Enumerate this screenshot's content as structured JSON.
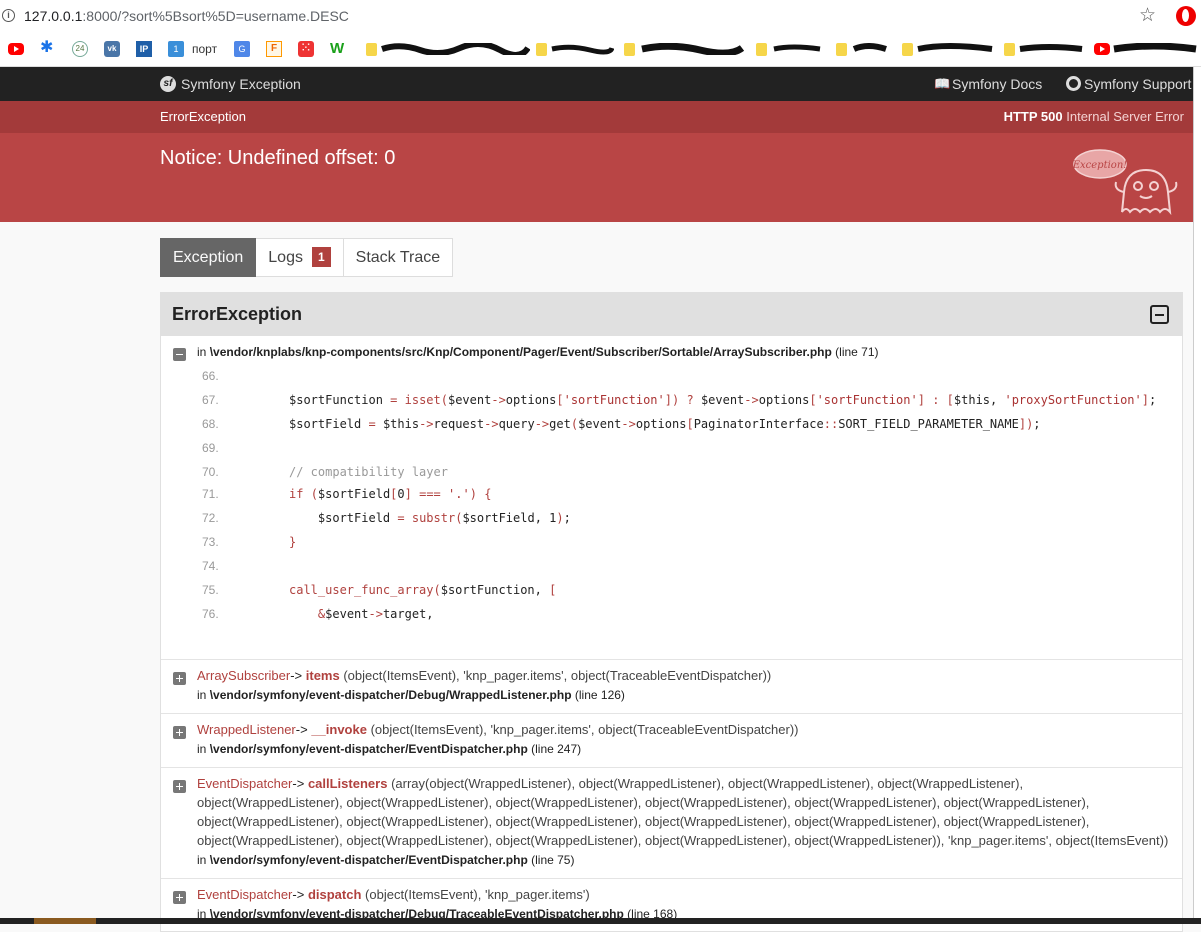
{
  "browser": {
    "url_host": "127.0.0.1",
    "url_rest": ":8000/?sort%5Bsort%5D=username.DESC",
    "bookmark_text": "порт"
  },
  "header": {
    "title": "Symfony Exception",
    "docs": "Symfony Docs",
    "support": "Symfony Support"
  },
  "error": {
    "class": "ErrorException",
    "status_code": "HTTP 500",
    "status_text": "Internal Server Error",
    "message": "Notice: Undefined offset: 0",
    "ghost_label": "Exception!"
  },
  "tabs": [
    {
      "label": "Exception"
    },
    {
      "label": "Logs",
      "badge": "1"
    },
    {
      "label": "Stack Trace"
    }
  ],
  "panel": {
    "title": "ErrorException",
    "first_trace": {
      "prefix": "in",
      "file": "\\vendor/knplabs/knp-components/src/Knp/Component/Pager/Event/Subscriber/Sortable/ArraySubscriber.php",
      "line": "(line 71)"
    },
    "code_lines": [
      {
        "num": "66.",
        "code": ""
      },
      {
        "num": "67.",
        "code": "        $sortFunction = isset($event->options['sortFunction']) ? $event->options['sortFunction'] : [$this, 'proxySortFunction'];"
      },
      {
        "num": "68.",
        "code": "        $sortField = $this->request->query->get($event->options[PaginatorInterface::SORT_FIELD_PARAMETER_NAME]);"
      },
      {
        "num": "69.",
        "code": ""
      },
      {
        "num": "70.",
        "code": "        // compatibility layer"
      },
      {
        "num": "71.",
        "code": "        if ($sortField[0] === '.') {"
      },
      {
        "num": "72.",
        "code": "            $sortField = substr($sortField, 1);"
      },
      {
        "num": "73.",
        "code": "        }"
      },
      {
        "num": "74.",
        "code": ""
      },
      {
        "num": "75.",
        "code": "        call_user_func_array($sortFunction, ["
      },
      {
        "num": "76.",
        "code": "            &$event->target,"
      }
    ],
    "traces": [
      {
        "cls": "ArraySubscriber",
        "arrow": "->",
        "fn": "items",
        "args": "(object(ItemsEvent), 'knp_pager.items', object(TraceableEventDispatcher))",
        "prefix": "in",
        "file": "\\vendor/symfony/event-dispatcher/Debug/WrappedListener.php",
        "line": "(line 126)"
      },
      {
        "cls": "WrappedListener",
        "arrow": "->",
        "fn": "__invoke",
        "args": "(object(ItemsEvent), 'knp_pager.items', object(TraceableEventDispatcher))",
        "prefix": "in",
        "file": "\\vendor/symfony/event-dispatcher/EventDispatcher.php",
        "line": "(line 247)"
      },
      {
        "cls": "EventDispatcher",
        "arrow": "->",
        "fn": "callListeners",
        "args": "(array(object(WrappedListener), object(WrappedListener), object(WrappedListener), object(WrappedListener), object(WrappedListener), object(WrappedListener), object(WrappedListener), object(WrappedListener), object(WrappedListener), object(WrappedListener), object(WrappedListener), object(WrappedListener), object(WrappedListener), object(WrappedListener), object(WrappedListener), object(WrappedListener), object(WrappedListener), object(WrappedListener), object(WrappedListener), object(WrappedListener), object(WrappedListener)), 'knp_pager.items', object(ItemsEvent))",
        "prefix": "in",
        "file": "\\vendor/symfony/event-dispatcher/EventDispatcher.php",
        "line": "(line 75)"
      },
      {
        "cls": "EventDispatcher",
        "arrow": "->",
        "fn": "dispatch",
        "args": "(object(ItemsEvent), 'knp_pager.items')",
        "prefix": "in",
        "file": "\\vendor/symfony/event-dispatcher/Debug/TraceableEventDispatcher.php",
        "line": "(line 168)"
      }
    ]
  },
  "colors": {
    "header_bg": "#222222",
    "error_sub_bg": "#a33a3a",
    "error_main_bg": "#b94545",
    "accent": "#b0413e"
  }
}
